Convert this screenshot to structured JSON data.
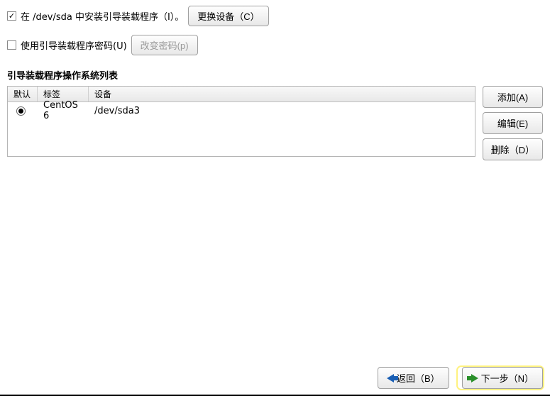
{
  "install_bootloader": {
    "checked": true,
    "label": "在 /dev/sda 中安装引导装载程序（I）。",
    "change_device_btn": "更换设备（C）"
  },
  "use_password": {
    "checked": false,
    "label": "使用引导装载程序密码(U)",
    "change_password_btn": "改变密码(p)"
  },
  "os_list": {
    "title": "引导装载程序操作系统列表",
    "columns": {
      "default": "默认",
      "label": "标签",
      "device": "设备"
    },
    "rows": [
      {
        "selected": true,
        "label": "CentOS 6",
        "device": "/dev/sda3"
      }
    ]
  },
  "side_buttons": {
    "add": "添加(A)",
    "edit": "编辑(E)",
    "delete": "删除（D）"
  },
  "footer": {
    "back": "返回（B）",
    "next": "下一步（N）"
  }
}
